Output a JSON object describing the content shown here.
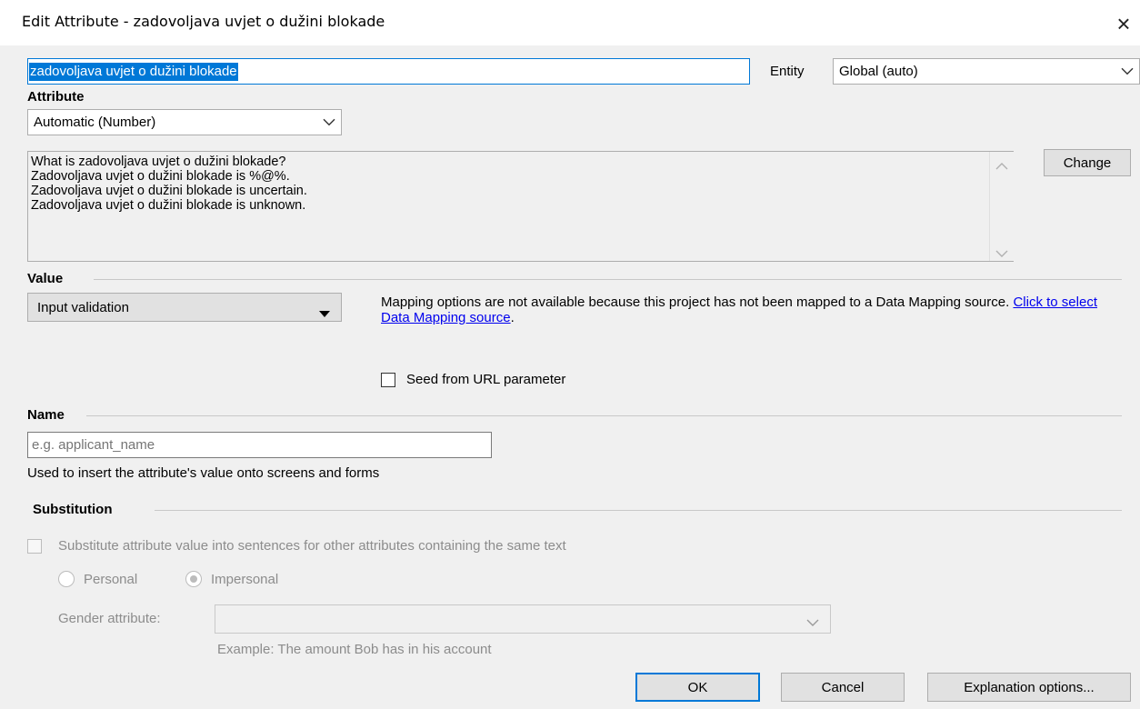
{
  "window": {
    "title": "Edit Attribute - zadovoljava uvjet o dužini blokade",
    "close_glyph": "×"
  },
  "attribute_text": {
    "value": "zadovoljava uvjet o dužini blokade"
  },
  "entity": {
    "label": "Entity",
    "selected": "Global (auto)"
  },
  "attribute_section": {
    "label": "Attribute",
    "type_selected": "Automatic (Number)"
  },
  "sentences": {
    "lines": [
      "What is zadovoljava uvjet o dužini blokade?",
      "Zadovoljava uvjet o dužini blokade is %@%.",
      "Zadovoljava uvjet o dužini blokade is uncertain.",
      "Zadovoljava uvjet o dužini blokade is unknown."
    ],
    "change_label": "Change"
  },
  "value_section": {
    "label": "Value",
    "selected": "Input validation",
    "mapping_text": "Mapping options are not available because this project has not been mapped to a Data Mapping source.",
    "mapping_link": "Click to select Data Mapping source",
    "mapping_suffix": ".",
    "seed_label": "Seed from URL parameter"
  },
  "name_section": {
    "label": "Name",
    "placeholder": "e.g. applicant_name",
    "help": "Used to insert the attribute's value onto screens and forms"
  },
  "substitution_section": {
    "label": "Substitution",
    "substitute_label": "Substitute attribute value into sentences for other attributes containing the same text",
    "personal_label": "Personal",
    "impersonal_label": "Impersonal",
    "gender_label": "Gender attribute:",
    "example": "Example: The amount Bob has in his account"
  },
  "footer": {
    "ok_label": "OK",
    "cancel_label": "Cancel",
    "explanation_label": "Explanation options..."
  },
  "icons": {
    "chevron_down": "chevron-down-icon",
    "dropdown_arrow": "dropdown-arrow-icon",
    "scroll_up": "scroll-up-icon",
    "scroll_down": "scroll-down-icon"
  },
  "colors": {
    "selection": "#0078d7",
    "link": "#0000ee",
    "dialog_bg": "#f0f0f0"
  }
}
